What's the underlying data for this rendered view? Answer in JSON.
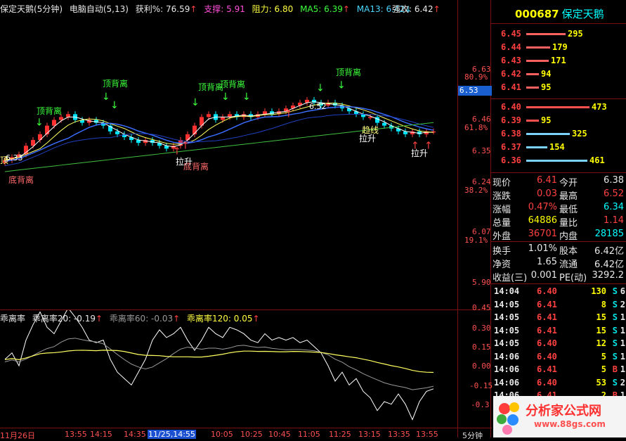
{
  "main_header": {
    "title": "保定天鹅(5分钟)",
    "formula": "电脑自动(5,13)",
    "profit": "获利%: 76.59",
    "profit_arrow": "↑",
    "support": "支撑: 5.91",
    "resistance": "阻力: 6.80",
    "ma5": "MA5: 6.39",
    "ma5_arrow": "↑",
    "ma13": "MA13: 6.42",
    "ma13_arrow": "↓",
    "strong": "强攻: 6.42",
    "strong_arrow": "↑"
  },
  "price_axis": [
    {
      "label": "6.63",
      "pct": "80.9%"
    },
    {
      "label": "6.46",
      "pct": "61.8%"
    },
    {
      "label": "6.35",
      "pct": ""
    },
    {
      "label": "6.24",
      "pct": "38.2%"
    },
    {
      "label": "6.07",
      "pct": "19.1%"
    },
    {
      "label": "5.90",
      "pct": ""
    }
  ],
  "current_price_tag": "6.53",
  "annotations": {
    "top1": "顶背离",
    "top2": "顶背离",
    "top3": "顶背离",
    "top4": "顶背离",
    "top5": "顶背离",
    "bottom1": "底背离",
    "bottom2": "底背离",
    "pull1": "拉升",
    "pull2": "拉升",
    "pull3": "拉升",
    "trend": "趋线",
    "price_mark_high": "6.52",
    "price_mark_low": "6.33",
    "left_cut": "顶"
  },
  "sub_header": {
    "name": "乖离率",
    "bias20": "乖离率20: -0.19",
    "bias20_arrow": "↑",
    "bias60": "乖离率60: -0.03",
    "bias60_arrow": "↑",
    "bias120": "乖离率120: 0.05",
    "bias120_arrow": "↑"
  },
  "sub_axis": [
    "0.45",
    "0.30",
    "0.15",
    "0.00",
    "-0.15",
    "-0.3"
  ],
  "time_axis": [
    "11月26日",
    "13:55",
    "14:15",
    "14:35",
    "11/25,14:55",
    "10:05",
    "10:25",
    "10:45",
    "11:05",
    "11:25",
    "13:15",
    "13:35",
    "13:55"
  ],
  "time_unit": "5分钟",
  "stock": {
    "code": "000687",
    "name": "保定天鹅"
  },
  "order_book_sell": [
    {
      "price": "6.45",
      "vol": "295",
      "bar": 0.62
    },
    {
      "price": "6.44",
      "vol": "179",
      "bar": 0.38
    },
    {
      "price": "6.43",
      "vol": "171",
      "bar": 0.36
    },
    {
      "price": "6.42",
      "vol": "94",
      "bar": 0.2
    },
    {
      "price": "6.41",
      "vol": "95",
      "bar": 0.2
    }
  ],
  "order_book_buy": [
    {
      "price": "6.40",
      "vol": "473",
      "bar": 1.0,
      "color": "#ff5050"
    },
    {
      "price": "6.39",
      "vol": "95",
      "bar": 0.2,
      "color": "#ff5050"
    },
    {
      "price": "6.38",
      "vol": "325",
      "bar": 0.69,
      "color": "#7ad3ff"
    },
    {
      "price": "6.37",
      "vol": "154",
      "bar": 0.33,
      "color": "#7ad3ff"
    },
    {
      "price": "6.36",
      "vol": "461",
      "bar": 0.97,
      "color": "#7ad3ff"
    }
  ],
  "quote": [
    {
      "l1": "现价",
      "v1": "6.41",
      "c1": "#ff4040",
      "l2": "今开",
      "v2": "6.38",
      "c2": "#e8e8e8"
    },
    {
      "l1": "涨跌",
      "v1": "0.03",
      "c1": "#ff4040",
      "l2": "最高",
      "v2": "6.52",
      "c2": "#ff4040"
    },
    {
      "l1": "涨幅",
      "v1": "0.47%",
      "c1": "#ff4040",
      "l2": "最低",
      "v2": "6.34",
      "c2": "#00ffff"
    },
    {
      "l1": "总量",
      "v1": "64886",
      "c1": "#ffff00",
      "l2": "量比",
      "v2": "1.14",
      "c2": "#ff4040"
    },
    {
      "l1": "外盘",
      "v1": "36701",
      "c1": "#ff4040",
      "l2": "内盘",
      "v2": "28185",
      "c2": "#00ffff"
    },
    {
      "l1": "换手",
      "v1": "1.01%",
      "c1": "#e8e8e8",
      "l2": "股本",
      "v2": "6.42亿",
      "c2": "#e8e8e8"
    },
    {
      "l1": "净资",
      "v1": "1.65",
      "c1": "#e8e8e8",
      "l2": "流通",
      "v2": "6.42亿",
      "c2": "#e8e8e8"
    },
    {
      "l1": "收益(三)",
      "v1": "0.001",
      "c1": "#e8e8e8",
      "l2": "PE(动)",
      "v2": "3292.2",
      "c2": "#e8e8e8"
    }
  ],
  "trades": [
    {
      "time": "14:04",
      "price": "6.40",
      "vol": "130",
      "side": "S",
      "n": "6"
    },
    {
      "time": "14:05",
      "price": "6.41",
      "vol": "8",
      "side": "S",
      "n": "2"
    },
    {
      "time": "14:05",
      "price": "6.41",
      "vol": "15",
      "side": "S",
      "n": "1"
    },
    {
      "time": "14:05",
      "price": "6.41",
      "vol": "15",
      "side": "S",
      "n": "1"
    },
    {
      "time": "14:05",
      "price": "6.40",
      "vol": "12",
      "side": "S",
      "n": "1"
    },
    {
      "time": "14:06",
      "price": "6.40",
      "vol": "5",
      "side": "S",
      "n": "1"
    },
    {
      "time": "14:06",
      "price": "6.41",
      "vol": "5",
      "side": "B",
      "n": "1"
    },
    {
      "time": "14:06",
      "price": "6.40",
      "vol": "53",
      "side": "S",
      "n": "2"
    },
    {
      "time": "14:06",
      "price": "6.41",
      "vol": "2",
      "side": "B",
      "n": "1"
    }
  ],
  "logo": {
    "text": "分析家公式网",
    "url": "www.88gs.com"
  },
  "colors": {
    "up": "#ff4040",
    "down": "#00ffff",
    "grid": "#7a1010",
    "ma_white": "#ffffff",
    "ma_yellow": "#ffff60",
    "ma_blue": "#3a6cff",
    "ma_green": "#40c040"
  }
}
